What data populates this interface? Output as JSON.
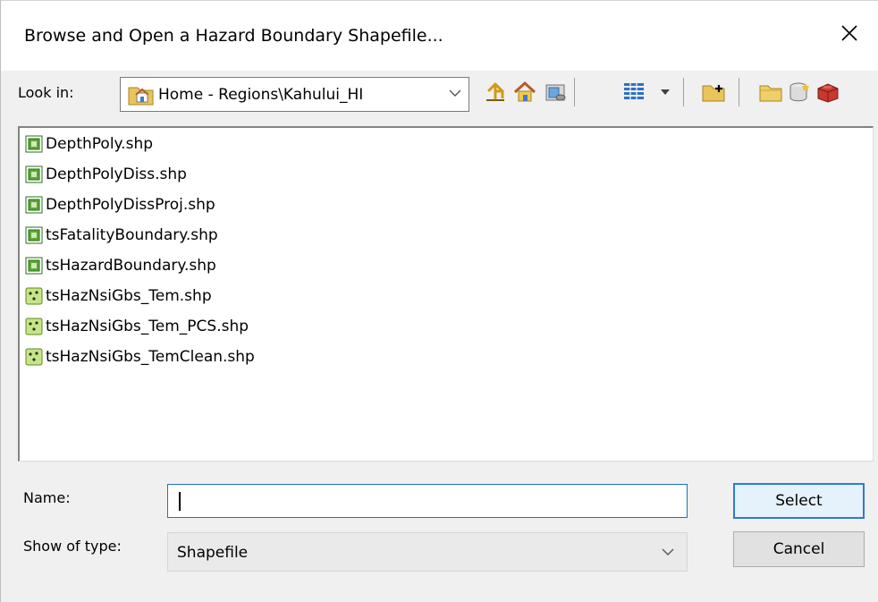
{
  "dialog": {
    "title": "Browse and Open a Hazard Boundary Shapefile...",
    "close_icon": "close-icon"
  },
  "lookin": {
    "label": "Look in:",
    "value": "Home - Regions\\Kahului_HI",
    "folder_icon": "home-folder-icon"
  },
  "toolbar": {
    "icons": [
      "up-one-level-icon",
      "home-icon",
      "catalog-icon",
      "view-options-icon",
      "connect-folder-icon",
      "new-folder-icon",
      "new-geodatabase-icon",
      "toolbox-icon"
    ]
  },
  "files": [
    {
      "name": "DepthPoly.shp",
      "icon": "polygon-shapefile-icon"
    },
    {
      "name": "DepthPolyDiss.shp",
      "icon": "polygon-shapefile-icon"
    },
    {
      "name": "DepthPolyDissProj.shp",
      "icon": "polygon-shapefile-icon"
    },
    {
      "name": "tsFatalityBoundary.shp",
      "icon": "polygon-shapefile-icon"
    },
    {
      "name": "tsHazardBoundary.shp",
      "icon": "polygon-shapefile-icon"
    },
    {
      "name": "tsHazNsiGbs_Tem.shp",
      "icon": "point-shapefile-icon"
    },
    {
      "name": "tsHazNsiGbs_Tem_PCS.shp",
      "icon": "point-shapefile-icon"
    },
    {
      "name": "tsHazNsiGbs_TemClean.shp",
      "icon": "point-shapefile-icon"
    }
  ],
  "name_field": {
    "label": "Name:",
    "value": ""
  },
  "type_field": {
    "label": "Show of type:",
    "value": "Shapefile"
  },
  "buttons": {
    "select": "Select",
    "cancel": "Cancel"
  },
  "colors": {
    "focus_border": "#1f6fc4",
    "polygon_icon": "#5aa832",
    "point_icon": "#a8d25a"
  }
}
